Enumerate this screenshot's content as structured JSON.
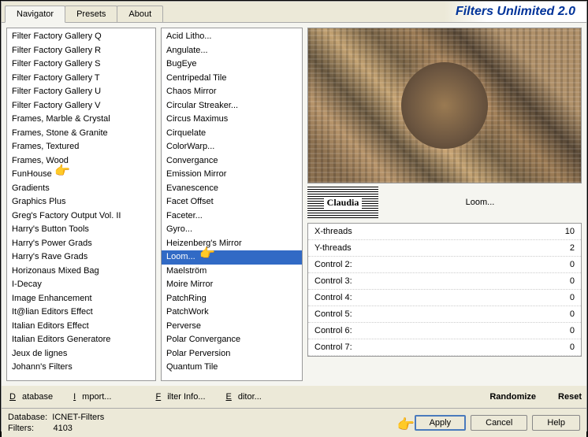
{
  "brand": "Filters Unlimited 2.0",
  "tabs": [
    {
      "label": "Navigator",
      "active": true
    },
    {
      "label": "Presets",
      "active": false
    },
    {
      "label": "About",
      "active": false
    }
  ],
  "categories": [
    "Filter Factory Gallery Q",
    "Filter Factory Gallery R",
    "Filter Factory Gallery S",
    "Filter Factory Gallery T",
    "Filter Factory Gallery U",
    "Filter Factory Gallery V",
    "Frames, Marble & Crystal",
    "Frames, Stone & Granite",
    "Frames, Textured",
    "Frames, Wood",
    "FunHouse",
    "Gradients",
    "Graphics Plus",
    "Greg's Factory Output Vol. II",
    "Harry's Button Tools",
    "Harry's Power Grads",
    "Harry's Rave Grads",
    "Horizonaus Mixed Bag",
    "I-Decay",
    "Image Enhancement",
    "It@lian Editors Effect",
    "Italian Editors Effect",
    "Italian Editors Generatore",
    "Jeux de lignes",
    "Johann's Filters"
  ],
  "category_pointer_index": 10,
  "filters": [
    "Acid Litho...",
    "Angulate...",
    "BugEye",
    "Centripedal Tile",
    "Chaos Mirror",
    "Circular Streaker...",
    "Circus Maximus",
    "Cirquelate",
    "ColorWarp...",
    "Convergance",
    "Emission Mirror",
    "Evanescence",
    "Facet Offset",
    "Faceter...",
    "Gyro...",
    "Heizenberg's Mirror",
    "Loom...",
    "Maelström",
    "Moire Mirror",
    "PatchRing",
    "PatchWork",
    "Perverse",
    "Polar Convergance",
    "Polar Perversion",
    "Quantum Tile"
  ],
  "filter_selected_index": 16,
  "current_filter": "Loom...",
  "logo_text": "Claudia",
  "params": [
    {
      "label": "X-threads",
      "value": "10"
    },
    {
      "label": "Y-threads",
      "value": "2"
    },
    {
      "label": "Control 2:",
      "value": "0"
    },
    {
      "label": "Control 3:",
      "value": "0"
    },
    {
      "label": "Control 4:",
      "value": "0"
    },
    {
      "label": "Control 5:",
      "value": "0"
    },
    {
      "label": "Control 6:",
      "value": "0"
    },
    {
      "label": "Control 7:",
      "value": "0"
    }
  ],
  "toolbar": {
    "database": "Database",
    "import": "Import...",
    "filter_info": "Filter Info...",
    "editor": "Editor...",
    "randomize": "Randomize",
    "reset": "Reset"
  },
  "footer": {
    "db_label": "Database:",
    "db_value": "ICNET-Filters",
    "filters_label": "Filters:",
    "filters_value": "4103",
    "apply": "Apply",
    "cancel": "Cancel",
    "help": "Help"
  }
}
